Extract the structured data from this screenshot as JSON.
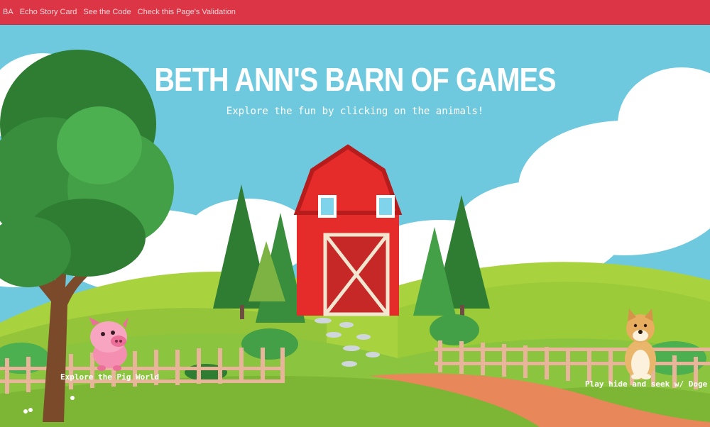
{
  "nav": {
    "items": [
      {
        "label": "BA"
      },
      {
        "label": "Echo Story Card"
      },
      {
        "label": "See the Code"
      },
      {
        "label": "Check this Page's Validation"
      }
    ]
  },
  "header": {
    "title": "BETH ANN'S BARN OF GAMES",
    "subtitle": "Explore the fun by clicking on the animals!"
  },
  "animals": {
    "pig": {
      "caption": "Explore the Pig World",
      "icon": "pig-icon"
    },
    "doge": {
      "caption": "Play hide and seek w/ Doge",
      "icon": "doge-icon"
    }
  },
  "colors": {
    "navbar": "#dc3545",
    "sky": "#6ec9df",
    "barn": "#e62b2b",
    "grass": "#8bc43f"
  }
}
